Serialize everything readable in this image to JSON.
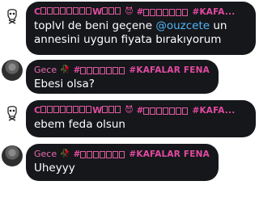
{
  "messages": [
    {
      "sender": "C̈ ⨯⨯⨯⨯⨯⨯⨯⨯ W ⨯⨯⨯",
      "sender_prefix": "C",
      "sender_letter": "W",
      "sender_emoji": "😈",
      "tag": "#KAFA...",
      "text_parts": [
        {
          "text": "toplvl de beni geçene "
        },
        {
          "text": "@ouzcete",
          "mention": true
        },
        {
          "text": " un annesini uygun fiyata bırakıyorum"
        }
      ],
      "avatar": "skull-avatar"
    },
    {
      "sender": "Gece",
      "sender_emoji": "🥀",
      "tag": "#KAFALAR FENA",
      "text": "Ebesi olsa?",
      "avatar": "dark-avatar"
    },
    {
      "sender_prefix": "C",
      "sender_letter": "W",
      "sender_emoji": "😈",
      "tag": "#KAFA...",
      "text": "ebem feda olsun",
      "avatar": "skull-avatar"
    },
    {
      "sender": "Gece",
      "sender_emoji": "🥀",
      "tag": "#KAFALAR FENA",
      "text": "Uheyyy",
      "avatar": "dark-avatar"
    }
  ]
}
